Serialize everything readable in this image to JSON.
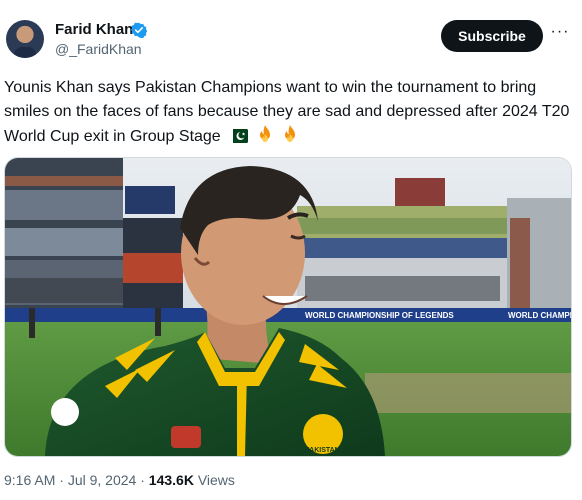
{
  "author": {
    "name": "Farid Khan",
    "handle": "@_FaridKhan"
  },
  "actions": {
    "subscribe_label": "Subscribe",
    "more_label": "···"
  },
  "tweet": {
    "text": "Younis Khan says Pakistan Champions want to win the tournament to bring smiles on the faces of fans because they are sad and depressed after 2024 T20 World Cup exit in Group Stage",
    "emojis": [
      "pakistan-flag",
      "fire",
      "fire"
    ]
  },
  "media": {
    "board_text_left": "WORLD CHAMPIONSHIP OF LEGENDS",
    "board_text_right": "WORLD CHAMPIONS",
    "shirt_badge": "PAKISTAN"
  },
  "meta": {
    "time": "9:16 AM",
    "separator": "·",
    "date": "Jul 9, 2024",
    "views_count": "143.6K",
    "views_label": "Views"
  }
}
